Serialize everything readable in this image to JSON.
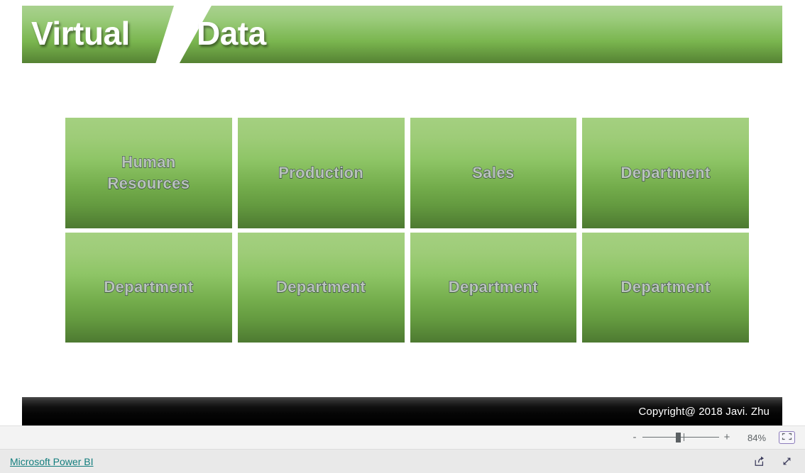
{
  "report": {
    "banner": {
      "word_1": "Virtual",
      "word_2": "Data",
      "gradient_top": "#a9d18e",
      "gradient_bottom": "#558233"
    },
    "cards": [
      {
        "label": "Human\nResources"
      },
      {
        "label": "Production"
      },
      {
        "label": "Sales"
      },
      {
        "label": "Department"
      },
      {
        "label": "Department"
      },
      {
        "label": "Department"
      },
      {
        "label": "Department"
      },
      {
        "label": "Department"
      }
    ],
    "card_style": {
      "gradient_top": "#a4d080",
      "gradient_bottom": "#4d7a31",
      "text_fill": "#b9c4bb",
      "text_outline": "#2b3347"
    },
    "footer": {
      "copyright": "Copyright@ 2018 Javi. Zhu",
      "background": "#000000"
    }
  },
  "zoom_bar": {
    "minus_label": "-",
    "plus_label": "+",
    "percent": "84%",
    "fit_icon": "fit-to-page-icon"
  },
  "status_bar": {
    "link_label": "Microsoft Power BI",
    "link_color": "#127d7d",
    "share_icon": "share-icon",
    "fullscreen_icon": "fullscreen-icon"
  }
}
